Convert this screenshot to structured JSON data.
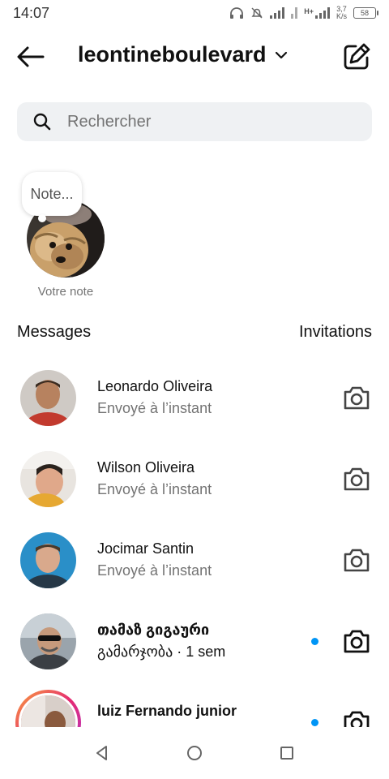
{
  "status_bar": {
    "time": "14:07",
    "network_type": "H+",
    "speed_value": "3,7",
    "speed_unit": "K/s",
    "battery": "58"
  },
  "header": {
    "username": "leontineboulevard"
  },
  "search": {
    "placeholder": "Rechercher"
  },
  "note": {
    "bubble_text": "Note...",
    "label": "Votre note"
  },
  "sections": {
    "messages_title": "Messages",
    "invitations_label": "Invitations"
  },
  "threads": [
    {
      "name": "Leonardo Oliveira",
      "subtitle": "Envoyé à l’instant",
      "unread": false
    },
    {
      "name": "Wilson Oliveira",
      "subtitle": "Envoyé à l’instant",
      "unread": false
    },
    {
      "name": "Jocimar Santin",
      "subtitle": "Envoyé à l’instant",
      "unread": false
    },
    {
      "name": "თამაზ გიგაური",
      "subtitle": "გამარჯობა · 1 sem",
      "unread": true
    },
    {
      "name": "luiz Fernando junior",
      "subtitle": "",
      "unread": true
    }
  ],
  "icons": {
    "back": "arrow-left-icon",
    "dropdown": "chevron-down-icon",
    "compose": "pencil-square-icon",
    "search": "search-icon",
    "camera": "camera-icon",
    "nav_back": "triangle-back-icon",
    "nav_home": "circle-home-icon",
    "nav_recents": "square-recents-icon"
  },
  "colors": {
    "unread_dot": "#0095f6",
    "story_ring_start": "#f9a13a",
    "story_ring_end": "#b136c9",
    "search_bg": "#eff1f3"
  }
}
